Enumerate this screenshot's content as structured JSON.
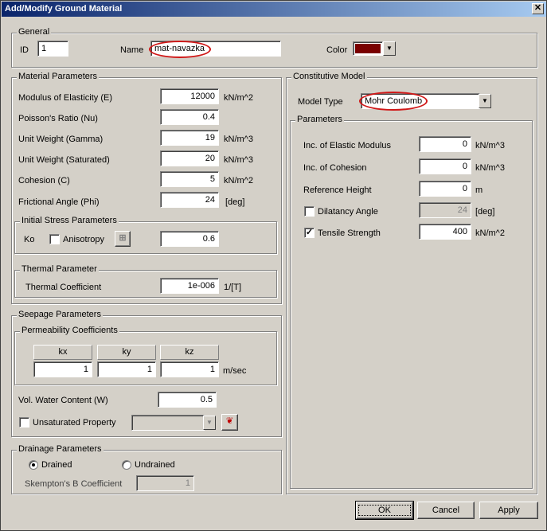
{
  "window": {
    "title": "Add/Modify Ground Material",
    "close": "✕"
  },
  "general": {
    "legend": "General",
    "id_label": "ID",
    "id_value": "1",
    "name_label": "Name",
    "name_value": "mat-navazka",
    "color_label": "Color",
    "color_value": "#7a0000"
  },
  "material": {
    "legend": "Material Parameters",
    "rows": [
      {
        "label": "Modulus of Elasticity (E)",
        "value": "12000",
        "unit": "kN/m^2"
      },
      {
        "label": "Poisson's Ratio (Nu)",
        "value": "0.4",
        "unit": ""
      },
      {
        "label": "Unit Weight (Gamma)",
        "value": "19",
        "unit": "kN/m^3"
      },
      {
        "label": "Unit Weight (Saturated)",
        "value": "20",
        "unit": "kN/m^3"
      },
      {
        "label": "Cohesion (C)",
        "value": "5",
        "unit": "kN/m^2"
      },
      {
        "label": "Frictional Angle (Phi)",
        "value": "24",
        "unit": "[deg]"
      }
    ],
    "initial_stress": {
      "legend": "Initial Stress Parameters",
      "ko_label": "Ko",
      "anisotropy_label": "Anisotropy",
      "ko_value": "0.6"
    },
    "thermal": {
      "legend": "Thermal Parameter",
      "label": "Thermal Coefficient",
      "value": "1e-006",
      "unit": "1/[T]"
    }
  },
  "seepage": {
    "legend": "Seepage Parameters",
    "perm_legend": "Permeability Coefficients",
    "headers": [
      "kx",
      "ky",
      "kz"
    ],
    "values": [
      "1",
      "1",
      "1"
    ],
    "unit": "m/sec",
    "vwc_label": "Vol. Water Content (W)",
    "vwc_value": "0.5",
    "unsat_label": "Unsaturated Property"
  },
  "drainage": {
    "legend": "Drainage Parameters",
    "drained_label": "Drained",
    "undrained_label": "Undrained",
    "skempton_label": "Skempton's B Coefficient",
    "skempton_value": "1"
  },
  "constitutive": {
    "legend": "Constitutive Model",
    "model_label": "Model Type",
    "model_value": "Mohr Coulomb",
    "params_legend": "Parameters",
    "rows": [
      {
        "label": "Inc. of Elastic Modulus",
        "value": "0",
        "unit": "kN/m^3"
      },
      {
        "label": "Inc. of Cohesion",
        "value": "0",
        "unit": "kN/m^3"
      },
      {
        "label": "Reference Height",
        "value": "0",
        "unit": "m"
      }
    ],
    "dilatancy_label": "Dilatancy Angle",
    "dilatancy_value": "24",
    "dilatancy_unit": "[deg]",
    "tensile_label": "Tensile Strength",
    "tensile_value": "400",
    "tensile_unit": "kN/m^2"
  },
  "buttons": {
    "ok": "OK",
    "cancel": "Cancel",
    "apply": "Apply"
  }
}
